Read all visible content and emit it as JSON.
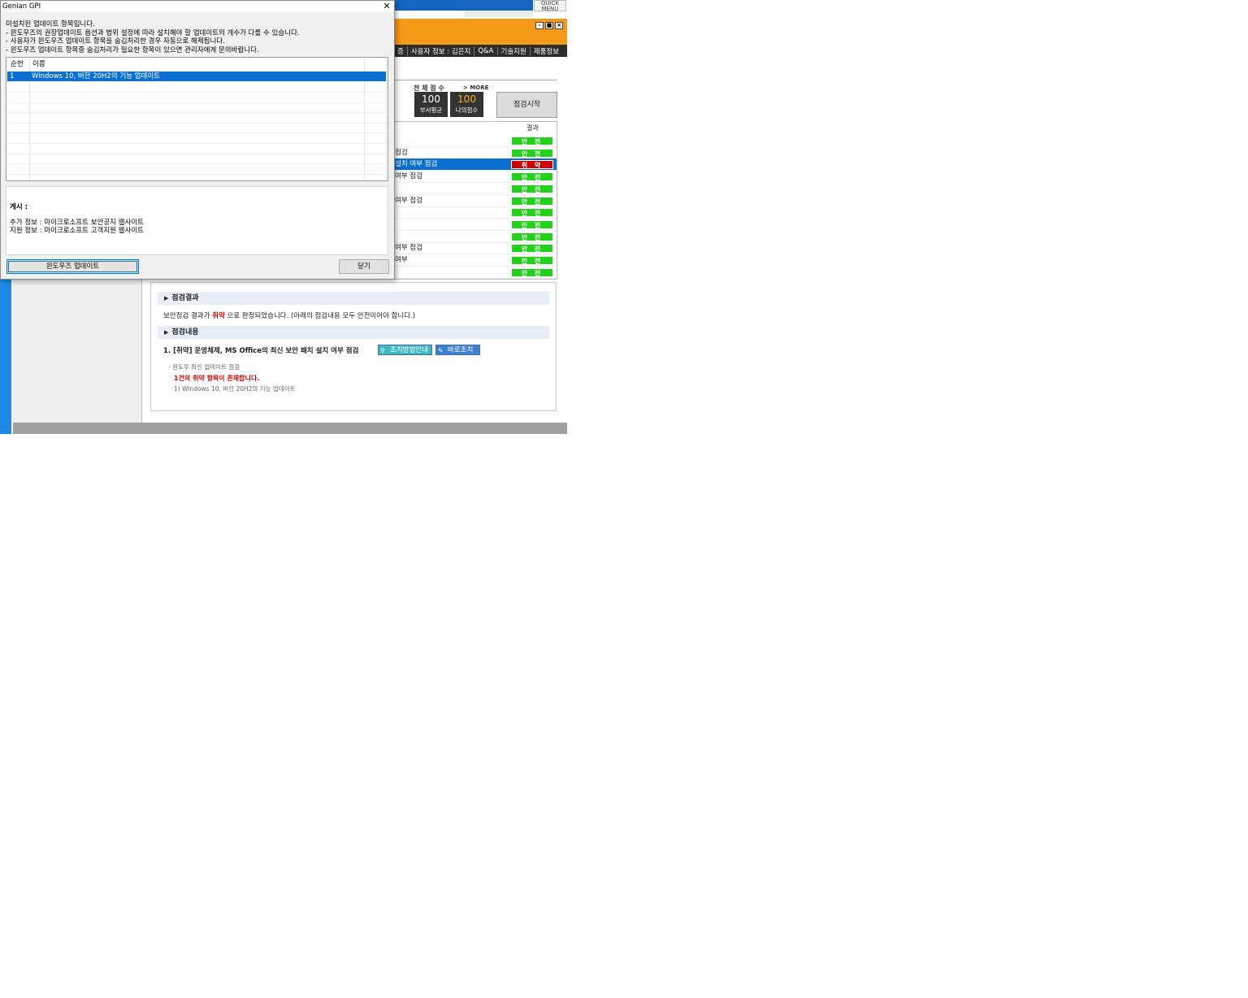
{
  "dialog": {
    "title": "Genian GPI",
    "message_lines": [
      "미설치된 업데이트 항목입니다.",
      " - 윈도우즈의 권장업데이트 옵션과 범위 설정에 따라 설치해야 할 업데이트의 개수가 다를 수 있습니다.",
      " - 사용자가 윈도우즈 업데이트 항목을 숨김처리한 경우 자동으로 해제됩니다.",
      " - 윈도우즈 업데이트 항목중 숨김처리가 필요한 항목이 있으면 관리자에게 문의바랍니다."
    ],
    "columns": [
      "순번",
      "이름"
    ],
    "rows": [
      {
        "index": "1",
        "name": "Windows 10, 버전 20H2의 기능 업데이트"
      }
    ],
    "info": {
      "heading": "게시 :",
      "additional": "추가 정보 : 마이크로소프트 보안공지 웹사이트",
      "support": "지원 정보 : 마이크로소프트 고객지원 웹사이트"
    },
    "buttons": {
      "windows_update": "윈도우즈 업데이트",
      "close": "닫기"
    }
  },
  "app": {
    "quick_menu": "QUICK\nMENU",
    "window_controls": [
      "-",
      "■",
      "×"
    ],
    "nav": [
      "증",
      "사용자 정보 : 김은지",
      "Q&A",
      "기술지원",
      "제품정보"
    ],
    "scores": {
      "overall_label": "전 체 점 수",
      "more_label": "> MORE",
      "dept_avg": {
        "value": "100",
        "label": "부서평균"
      },
      "my_score": {
        "value": "100",
        "label": "나의점수"
      }
    },
    "start_button": "점검시작",
    "result_header": "결과",
    "result_rows": [
      {
        "text": "",
        "result": "안 전",
        "status": "safe"
      },
      {
        "text": "점검",
        "result": "안 전",
        "status": "safe"
      },
      {
        "text": "설치 여부 점검",
        "result": "취 약",
        "status": "weak",
        "selected": true
      },
      {
        "text": "여부 점검",
        "result": "안 전",
        "status": "safe"
      },
      {
        "text": "",
        "result": "안 전",
        "status": "safe"
      },
      {
        "text": "여부 점검",
        "result": "안 전",
        "status": "safe"
      },
      {
        "text": "",
        "result": "안 전",
        "status": "safe"
      },
      {
        "text": "",
        "result": "안 전",
        "status": "safe"
      },
      {
        "text": "",
        "result": "안 전",
        "status": "safe"
      },
      {
        "text": "여부 점검",
        "result": "안 전",
        "status": "safe"
      },
      {
        "text": "여부",
        "result": "안 전",
        "status": "safe"
      },
      {
        "text": "",
        "result": "안 전",
        "status": "safe"
      }
    ],
    "detail": {
      "result_section": "점검결과",
      "result_prefix": "보안점검 결과가 ",
      "result_status": "취약",
      "result_suffix": " 으로 판정되었습니다. (아래의 점검내용 모두 안전이어야 합니다.)",
      "content_section": "점검내용",
      "item_title": "1. [취약] 운영체제, MS Office의 최신 보안 패치 설치 여부 점검",
      "guide_button": "조치방법안내",
      "fix_button": "바로조치",
      "sub_check": "- 윈도우 최신 업데이트 점검",
      "sub_warning": "1건의 취약 항목이 존재합니다.",
      "sub_item": "1) Windows 10, 버전 20H2의 기능 업데이트"
    },
    "colors": {
      "accent_blue": "#0a6fd0",
      "orange": "#f59a16",
      "safe_green": "#22d11a",
      "weak_red": "#d00000"
    }
  }
}
